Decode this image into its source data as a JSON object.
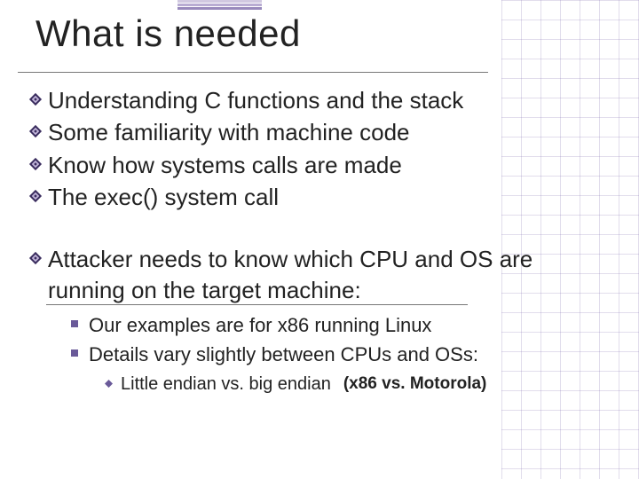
{
  "title": "What is needed",
  "bullets1": [
    "Understanding C functions and the stack",
    "Some familiarity with machine code",
    "Know how systems calls are made",
    "The exec() system call"
  ],
  "bullets1b": [
    "Attacker needs to know which CPU and OS are running on the target machine:"
  ],
  "bullets2": [
    "Our examples are for  x86  running  Linux",
    "Details vary slightly between CPUs and OSs:"
  ],
  "bullets3": [
    {
      "text": "Little endian vs. big endian",
      "paren": "(x86 vs. Motorola)"
    }
  ]
}
